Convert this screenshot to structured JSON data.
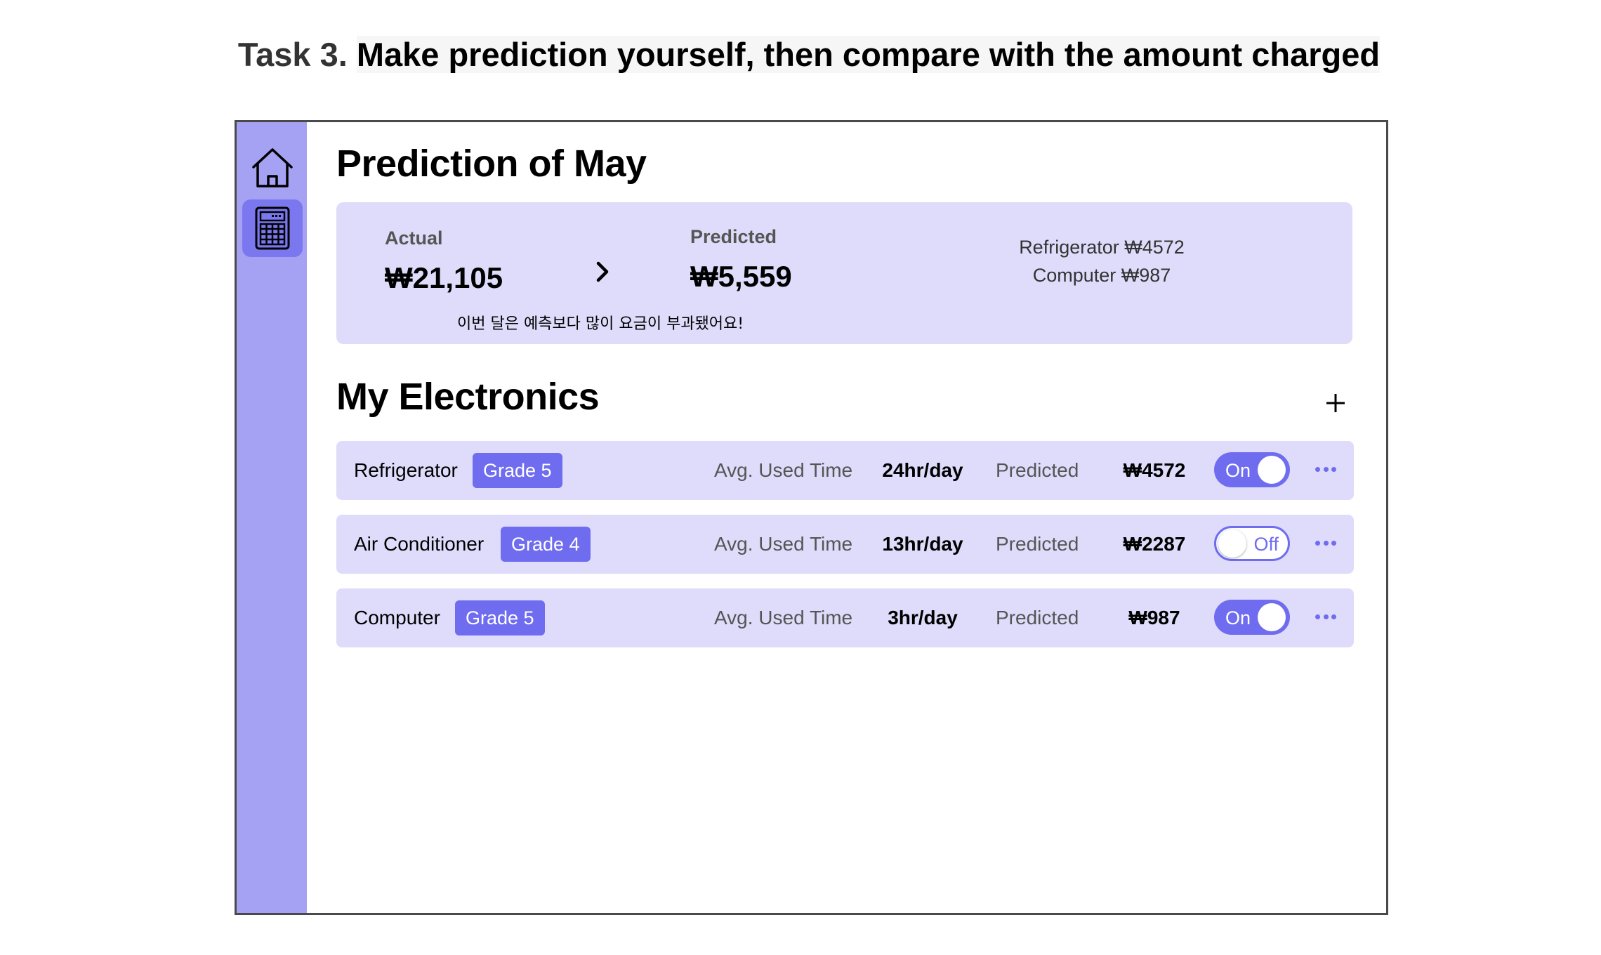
{
  "task": {
    "number": "Task 3.",
    "text": "Make prediction yourself, then compare with the amount charged"
  },
  "sidebar": {
    "items": [
      {
        "icon": "home-icon",
        "active": false
      },
      {
        "icon": "calculator-icon",
        "active": true
      }
    ]
  },
  "prediction": {
    "title": "Prediction of May",
    "actual_label": "Actual",
    "actual_value": "₩21,105",
    "predicted_label": "Predicted",
    "predicted_value": "₩5,559",
    "note": "이번 달은 예측보다 많이 요금이 부과됐어요!",
    "breakdown": [
      "Refrigerator ₩4572",
      "Computer ₩987"
    ]
  },
  "electronics": {
    "title": "My Electronics",
    "add_label": "+",
    "items": [
      {
        "name": "Refrigerator",
        "grade": "Grade 5",
        "avg_label": "Avg. Used Time",
        "avg_value": "24hr/day",
        "pred_label": "Predicted",
        "pred_value": "₩4572",
        "toggle": "On"
      },
      {
        "name": "Air Conditioner",
        "grade": "Grade 4",
        "avg_label": "Avg. Used Time",
        "avg_value": "13hr/day",
        "pred_label": "Predicted",
        "pred_value": "₩2287",
        "toggle": "Off"
      },
      {
        "name": "Computer",
        "grade": "Grade 5",
        "avg_label": "Avg. Used Time",
        "avg_value": "3hr/day",
        "pred_label": "Predicted",
        "pred_value": "₩987",
        "toggle": "On"
      }
    ]
  },
  "colors": {
    "accent": "#6f6cf0",
    "sidebar": "#a6a2f3",
    "card": "#dedcfa"
  }
}
